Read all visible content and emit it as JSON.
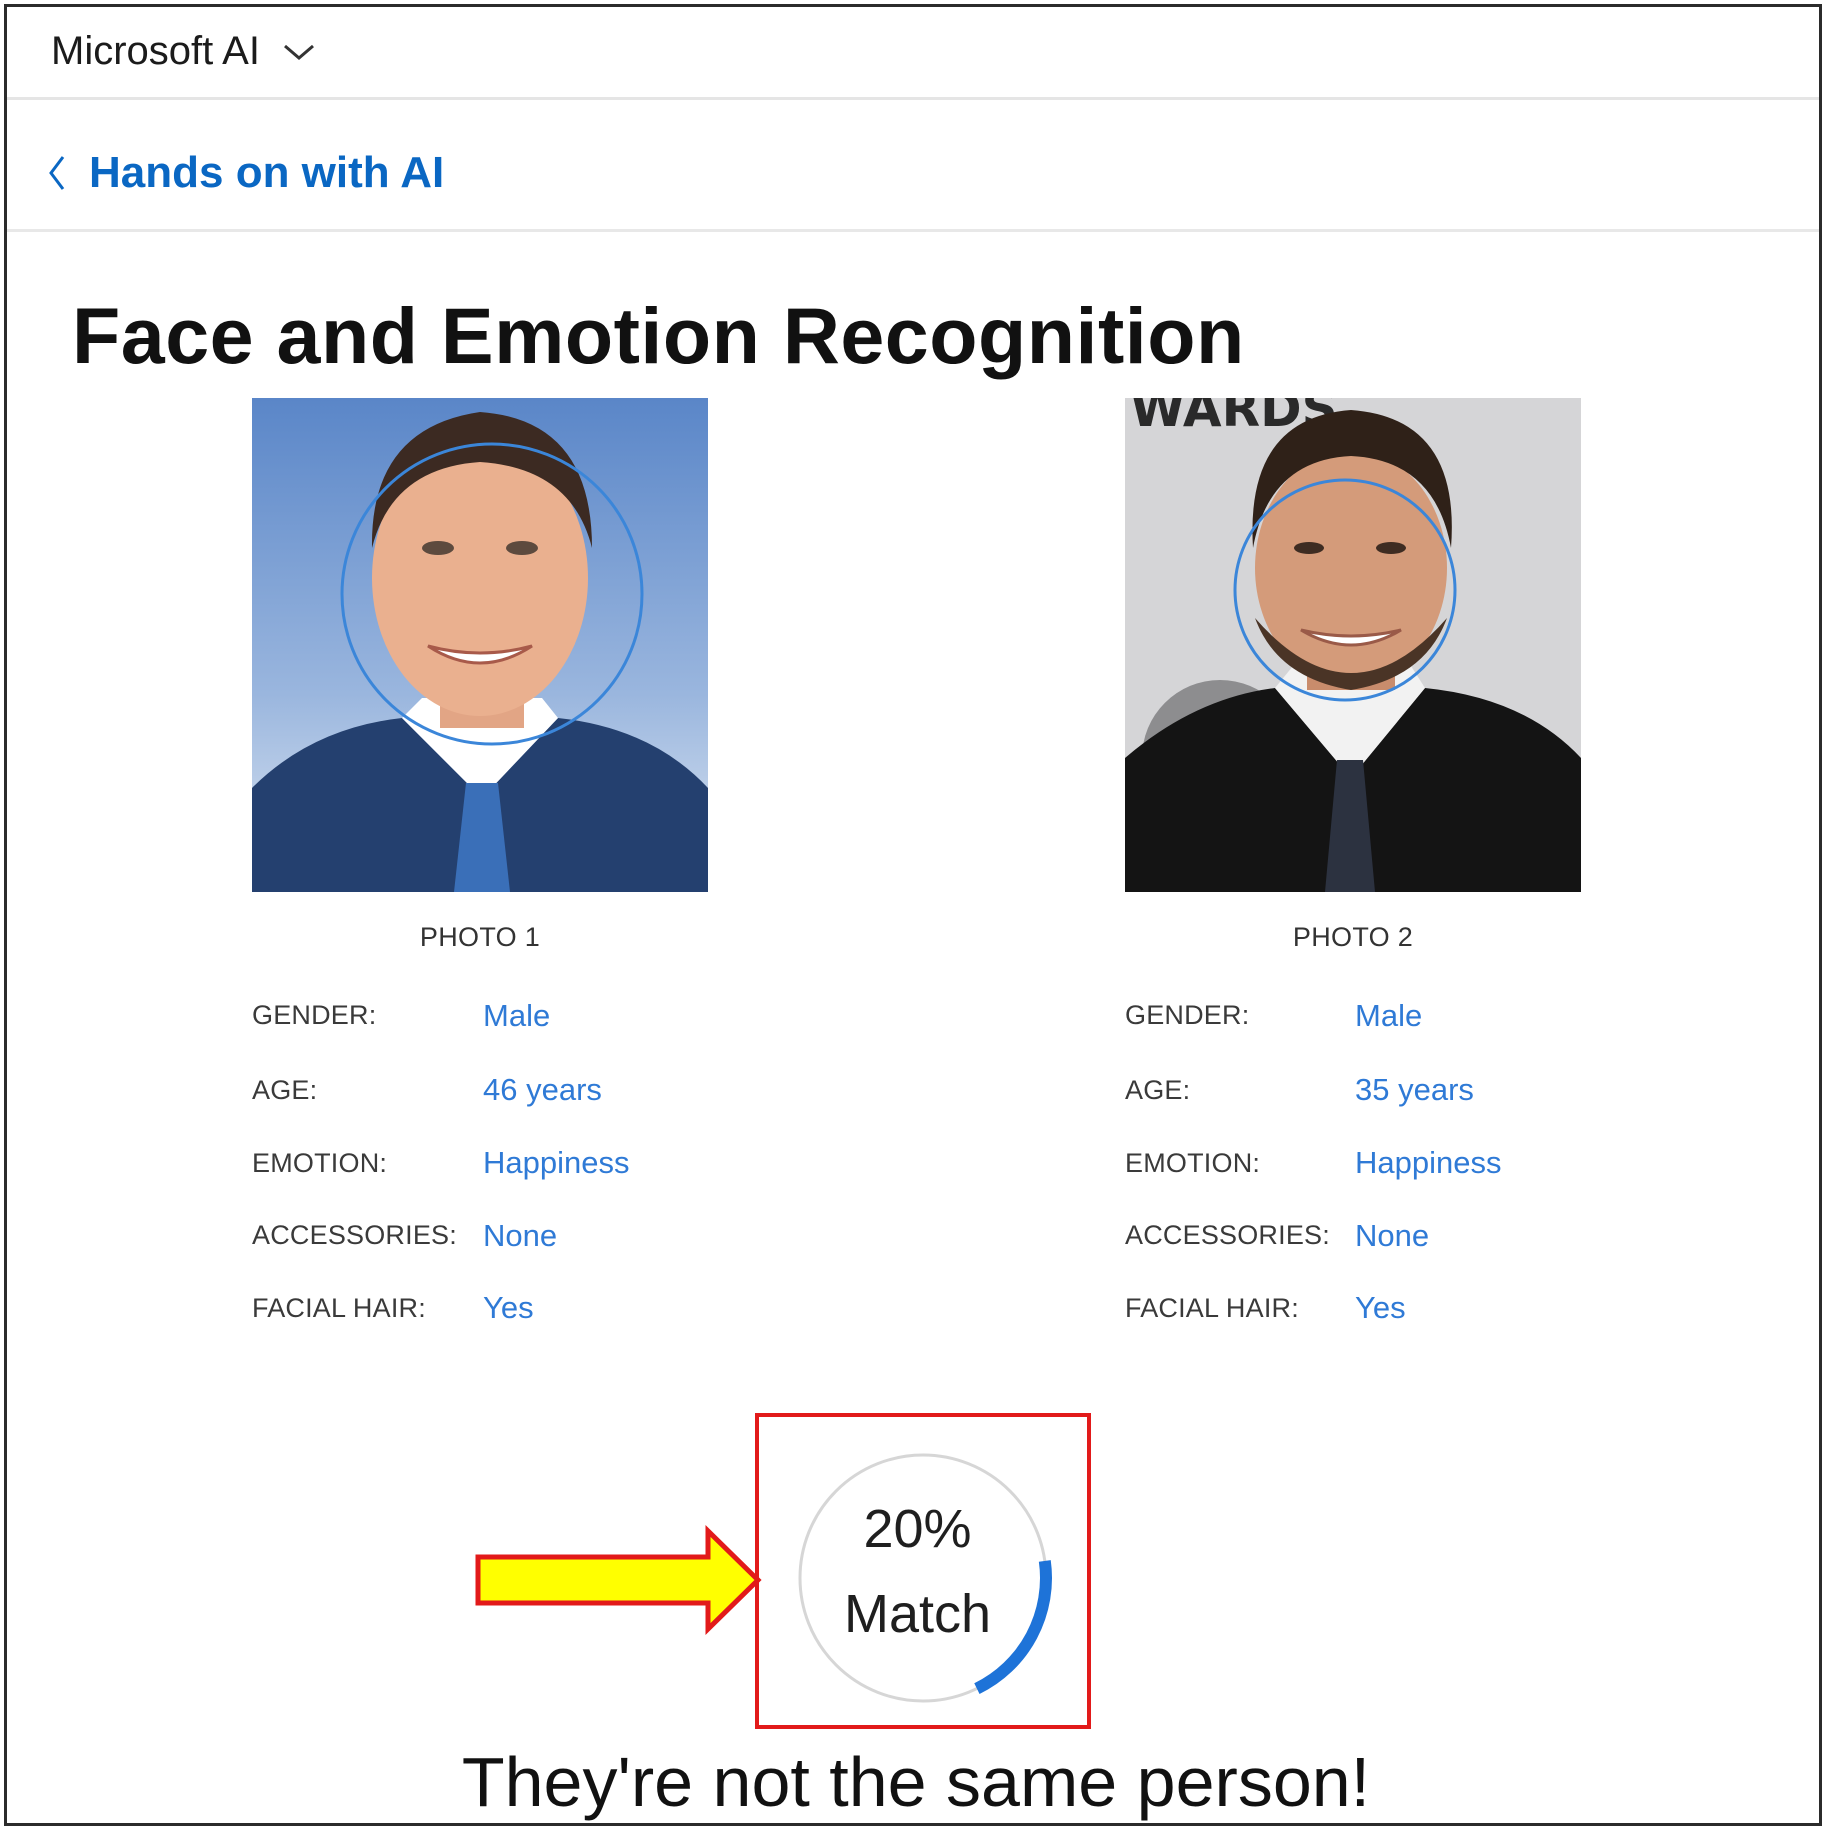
{
  "header": {
    "brand": "Microsoft AI",
    "dropdown_icon": "chevron-down-icon"
  },
  "nav": {
    "back_label": "Hands on with AI",
    "back_icon": "chevron-left-icon"
  },
  "page": {
    "title": "Face and Emotion Recognition"
  },
  "labels": {
    "gender": "GENDER:",
    "age": "AGE:",
    "emotion": "EMOTION:",
    "accessories": "ACCESSORIES:",
    "facial_hair": "FACIAL HAIR:"
  },
  "photos": [
    {
      "caption": "PHOTO 1",
      "gender": "Male",
      "age": "46 years",
      "emotion": "Happiness",
      "accessories": "None",
      "facial_hair": "Yes"
    },
    {
      "caption": "PHOTO 2",
      "gender": "Male",
      "age": "35 years",
      "emotion": "Happiness",
      "accessories": "None",
      "facial_hair": "Yes",
      "backdrop_text": "WARDS"
    }
  ],
  "match": {
    "percent_text": "20%",
    "label": "Match",
    "fraction": 0.2,
    "accent_color": "#1e73d8"
  },
  "annotation": {
    "arrow_icon": "right-arrow-icon",
    "arrow_color": "#ffff00",
    "box_color": "#e21a1a"
  },
  "verdict": "They're not the same person!"
}
